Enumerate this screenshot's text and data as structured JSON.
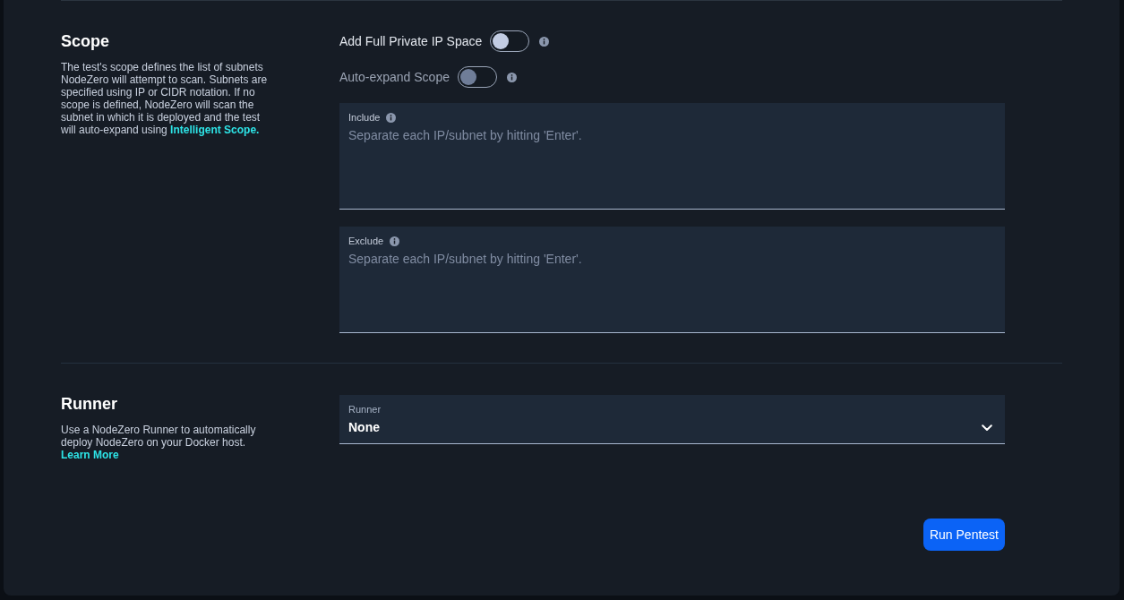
{
  "scope": {
    "title": "Scope",
    "description": "The test's scope defines the list of subnets NodeZero will attempt to scan. Subnets are specified using IP or CIDR notation. If no scope is defined, NodeZero will scan the subnet in which it is deployed and the test will auto-expand using",
    "link": "Intelligent Scope.",
    "toggles": [
      {
        "label": "Add Full Private IP Space",
        "on": false,
        "disabled": false
      },
      {
        "label": "Auto-expand Scope",
        "on": false,
        "disabled": true
      }
    ],
    "fields": [
      {
        "label": "Include",
        "placeholder": "Separate each IP/subnet by hitting 'Enter'."
      },
      {
        "label": "Exclude",
        "placeholder": "Separate each IP/subnet by hitting 'Enter'."
      }
    ]
  },
  "runner": {
    "title": "Runner",
    "description": "Use a NodeZero Runner to automatically deploy NodeZero on your Docker host.",
    "link": "Learn More",
    "select": {
      "label": "Runner",
      "value": "None"
    }
  },
  "run_button": "Run Pentest"
}
